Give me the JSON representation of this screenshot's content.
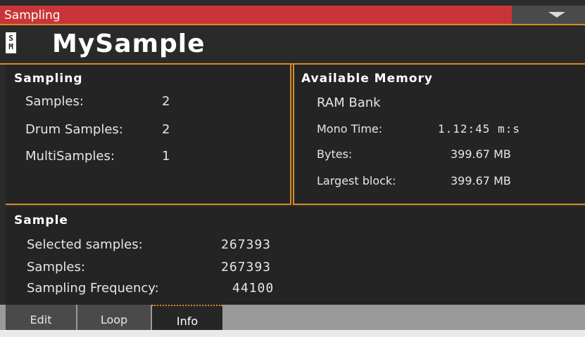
{
  "window": {
    "title": "Sampling"
  },
  "header": {
    "icon_glyph_top": "S",
    "icon_glyph_bottom": "M",
    "sample_name": "MySample"
  },
  "sampling": {
    "title": "Sampling",
    "rows": [
      {
        "label": "Samples:",
        "value": "2"
      },
      {
        "label": "Drum Samples:",
        "value": "2"
      },
      {
        "label": "MultiSamples:",
        "value": "1"
      }
    ]
  },
  "memory": {
    "title": "Available Memory",
    "bank": "RAM Bank",
    "rows": [
      {
        "label": "Mono Time:",
        "value": "1.12:45 m:s"
      },
      {
        "label": "Bytes:",
        "value": "399.67 MB"
      },
      {
        "label": "Largest block:",
        "value": "399.67 MB"
      }
    ]
  },
  "sample": {
    "title": "Sample",
    "rows": [
      {
        "label": "Selected samples:",
        "value": "267393"
      },
      {
        "label": "Samples:",
        "value": "267393"
      },
      {
        "label": "Sampling Frequency:",
        "value": "44100"
      }
    ]
  },
  "tabs": [
    {
      "label": "Edit",
      "active": false
    },
    {
      "label": "Loop",
      "active": false
    },
    {
      "label": "Info",
      "active": true
    }
  ]
}
